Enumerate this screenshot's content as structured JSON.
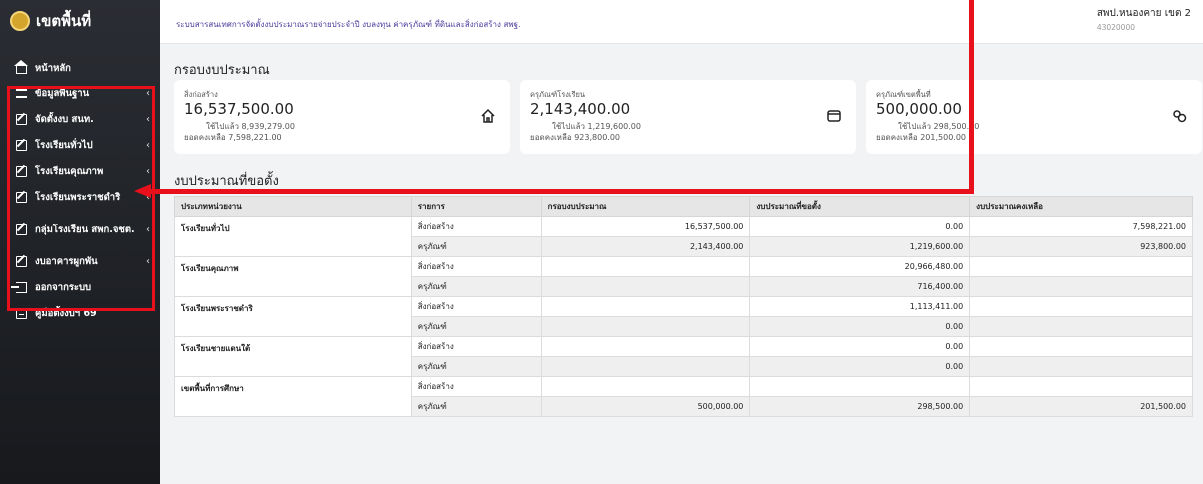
{
  "sidebar": {
    "brand": "เขตพื้นที่",
    "items": [
      {
        "label": "หน้าหลัก",
        "chevron": ""
      },
      {
        "label": "ข้อมูลพื้นฐาน",
        "chevron": "‹"
      },
      {
        "label": "จัดตั้งงบ สนท.",
        "chevron": "‹"
      },
      {
        "label": "โรงเรียนทั่วไป",
        "chevron": "‹"
      },
      {
        "label": "โรงเรียนคุณภาพ",
        "chevron": "‹"
      },
      {
        "label": "โรงเรียนพระราชดำริ",
        "chevron": "‹"
      },
      {
        "label": "กลุ่มโรงเรียน สพก.จชต.",
        "chevron": "‹"
      },
      {
        "label": "งบอาคารผูกพัน",
        "chevron": "‹"
      },
      {
        "label": "ออกจากระบบ",
        "chevron": ""
      },
      {
        "label": "คู่มือตั้งงบฯ 69",
        "chevron": ""
      }
    ]
  },
  "header": {
    "title": "ระบบสารสนเทศการจัดตั้งงบประมาณรายจ่ายประจำปี งบลงทุน ค่าครุภัณฑ์ ที่ดินและสิ่งก่อสร้าง สพฐ.",
    "user_name": "สพป.หนองคาย เขต 2",
    "user_code": "43020000"
  },
  "framework": {
    "title": "กรอบงบประมาณ",
    "cards": [
      {
        "label": "สิ่งก่อสร้าง",
        "value": "16,537,500.00",
        "used": "ใช้ไปแล้ว 8,939,279.00",
        "remaining": "ยอดคงเหลือ 7,598,221.00",
        "icon": "home-icon"
      },
      {
        "label": "ครุภัณฑ์โรงเรียน",
        "value": "2,143,400.00",
        "used": "ใช้ไปแล้ว 1,219,600.00",
        "remaining": "ยอดคงเหลือ 923,800.00",
        "icon": "wallet-icon"
      },
      {
        "label": "ครุภัณฑ์เขตพื้นที่",
        "value": "500,000.00",
        "used": "ใช้ไปแล้ว 298,500.00",
        "remaining": "ยอดคงเหลือ 201,500.00",
        "icon": "coins-icon"
      }
    ]
  },
  "requested": {
    "title": "งบประมาณที่ขอตั้ง",
    "columns": [
      "ประเภทหน่วยงาน",
      "รายการ",
      "กรอบงบประมาณ",
      "งบประมาณที่ขอตั้ง",
      "งบประมาณคงเหลือ"
    ],
    "groups": [
      {
        "name": "โรงเรียนทั่วไป",
        "rows": [
          {
            "item": "สิ่งก่อสร้าง",
            "frame": "16,537,500.00",
            "requested": "0.00",
            "remaining": "7,598,221.00"
          },
          {
            "item": "ครุภัณฑ์",
            "frame": "2,143,400.00",
            "requested": "1,219,600.00",
            "remaining": "923,800.00"
          }
        ]
      },
      {
        "name": "โรงเรียนคุณภาพ",
        "rows": [
          {
            "item": "สิ่งก่อสร้าง",
            "frame": "",
            "requested": "20,966,480.00",
            "remaining": ""
          },
          {
            "item": "ครุภัณฑ์",
            "frame": "",
            "requested": "716,400.00",
            "remaining": ""
          }
        ]
      },
      {
        "name": "โรงเรียนพระราชดำริ",
        "rows": [
          {
            "item": "สิ่งก่อสร้าง",
            "frame": "",
            "requested": "1,113,411.00",
            "remaining": ""
          },
          {
            "item": "ครุภัณฑ์",
            "frame": "",
            "requested": "0.00",
            "remaining": ""
          }
        ]
      },
      {
        "name": "โรงเรียนชายแดนใต้",
        "rows": [
          {
            "item": "สิ่งก่อสร้าง",
            "frame": "",
            "requested": "0.00",
            "remaining": ""
          },
          {
            "item": "ครุภัณฑ์",
            "frame": "",
            "requested": "0.00",
            "remaining": ""
          }
        ]
      },
      {
        "name": "เขตพื้นที่การศึกษา",
        "rows": [
          {
            "item": "สิ่งก่อสร้าง",
            "frame": "",
            "requested": "",
            "remaining": ""
          },
          {
            "item": "ครุภัณฑ์",
            "frame": "500,000.00",
            "requested": "298,500.00",
            "remaining": "201,500.00"
          }
        ]
      }
    ]
  },
  "colors": {
    "annotation_red": "#e8101a",
    "sidebar_bg": "#1f2226",
    "header_title": "#4b3a9a"
  }
}
